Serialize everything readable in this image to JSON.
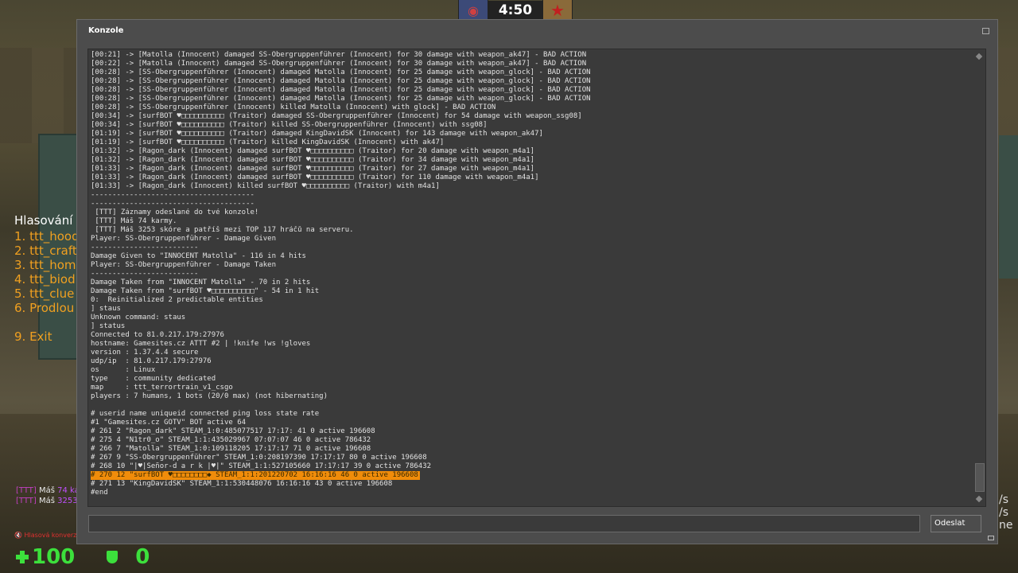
{
  "hud": {
    "timer": "4:50",
    "health": "100",
    "armor": "0",
    "voice_label": "Hlasová konverzace"
  },
  "vote_menu": {
    "title": "Hlasování",
    "items": [
      "1. ttt_hood",
      "2. ttt_craft",
      "3. ttt_home",
      "4. ttt_biod",
      "5. ttt_clue",
      "6. Prodlou"
    ],
    "exit": "9. Exit"
  },
  "chat": [
    {
      "tag": "[TTT]",
      "text": " Máš ",
      "num": "74 ka"
    },
    {
      "tag": "[TTT]",
      "text": " Máš ",
      "num": "3253"
    }
  ],
  "side_text": [
    "/s",
    "/s",
    "ne"
  ],
  "console": {
    "title": "Konzole",
    "send_label": "Odeslat",
    "input_value": "",
    "lines": [
      "[00:21] -> [Matolla (Innocent) damaged SS-Obergruppenführer (Innocent) for 30 damage with weapon_ak47] - BAD ACTION",
      "[00:22] -> [Matolla (Innocent) damaged SS-Obergruppenführer (Innocent) for 30 damage with weapon_ak47] - BAD ACTION",
      "[00:28] -> [SS-Obergruppenführer (Innocent) damaged Matolla (Innocent) for 25 damage with weapon_glock] - BAD ACTION",
      "[00:28] -> [SS-Obergruppenführer (Innocent) damaged Matolla (Innocent) for 25 damage with weapon_glock] - BAD ACTION",
      "[00:28] -> [SS-Obergruppenführer (Innocent) damaged Matolla (Innocent) for 25 damage with weapon_glock] - BAD ACTION",
      "[00:28] -> [SS-Obergruppenführer (Innocent) damaged Matolla (Innocent) for 25 damage with weapon_glock] - BAD ACTION",
      "[00:28] -> [SS-Obergruppenführer (Innocent) killed Matolla (Innocent) with glock] - BAD ACTION",
      "[00:34] -> [surfBOT ♥□□□□□□□□□□ (Traitor) damaged SS-Obergruppenführer (Innocent) for 54 damage with weapon_ssg08]",
      "[00:34] -> [surfBOT ♥□□□□□□□□□□ (Traitor) killed SS-Obergruppenführer (Innocent) with ssg08]",
      "[01:19] -> [surfBOT ♥□□□□□□□□□□ (Traitor) damaged KingDavidSK (Innocent) for 143 damage with weapon_ak47]",
      "[01:19] -> [surfBOT ♥□□□□□□□□□□ (Traitor) killed KingDavidSK (Innocent) with ak47]",
      "[01:32] -> [Ragon_dark (Innocent) damaged surfBOT ♥□□□□□□□□□□ (Traitor) for 20 damage with weapon_m4a1]",
      "[01:32] -> [Ragon_dark (Innocent) damaged surfBOT ♥□□□□□□□□□□ (Traitor) for 34 damage with weapon_m4a1]",
      "[01:33] -> [Ragon_dark (Innocent) damaged surfBOT ♥□□□□□□□□□□ (Traitor) for 27 damage with weapon_m4a1]",
      "[01:33] -> [Ragon_dark (Innocent) damaged surfBOT ♥□□□□□□□□□□ (Traitor) for 110 damage with weapon_m4a1]",
      "[01:33] -> [Ragon_dark (Innocent) killed surfBOT ♥□□□□□□□□□□ (Traitor) with m4a1]",
      "--------------------------------------",
      "--------------------------------------",
      " [TTT] Záznamy odeslané do tvé konzole!",
      " [TTT] Máš 74 karmy.",
      " [TTT] Máš 3253 skóre a patříš mezi TOP 117 hráčů na serveru.",
      "Player: SS-Obergruppenführer - Damage Given",
      "-------------------------",
      "Damage Given to \"INNOCENT Matolla\" - 116 in 4 hits",
      "Player: SS-Obergruppenführer - Damage Taken",
      "-------------------------",
      "Damage Taken from \"INNOCENT Matolla\" - 70 in 2 hits",
      "Damage Taken from \"surfBOT ♥□□□□□□□□□□\" - 54 in 1 hit",
      "0:  Reinitialized 2 predictable entities",
      "] staus",
      "Unknown command: staus",
      "] status",
      "Connected to 81.0.217.179:27976",
      "hostname: Gamesites.cz ATTT #2 | !knife !ws !gloves",
      "version : 1.37.4.4 secure",
      "udp/ip  : 81.0.217.179:27976",
      "os      : Linux",
      "type    : community dedicated",
      "map     : ttt_terrortrain_v1_csgo",
      "players : 7 humans, 1 bots (20/0 max) (not hibernating)",
      "",
      "# userid name uniqueid connected ping loss state rate",
      "#1 \"Gamesites.cz GOTV\" BOT active 64",
      "# 261 2 \"Ragon_dark\" STEAM_1:0:485077517 17:17: 41 0 active 196608",
      "# 275 4 \"N1tr0_o\" STEAM_1:1:435029967 07:07:07 46 0 active 786432",
      "# 266 7 \"Matolla\" STEAM_1:0:109118205 17:17:17 71 0 active 196608",
      "# 267 9 \"SS-Obergruppenführer\" STEAM_1:0:208197390 17:17:17 80 0 active 196608",
      "# 268 10 \"|♥|Señor-d a r k |♥|\" STEAM_1:1:527105660 17:17:17 39 0 active 786432",
      "# 270 12 \"surfBOT ♥□□□□□□□□◆ STEAM_1:1:201220702 16:16:16 46 0 active 196608",
      "# 271 13 \"KingDavidSK\" STEAM_1:1:530448076 16:16:16 43 0 active 196608",
      "#end"
    ],
    "highlight_index": 48
  }
}
